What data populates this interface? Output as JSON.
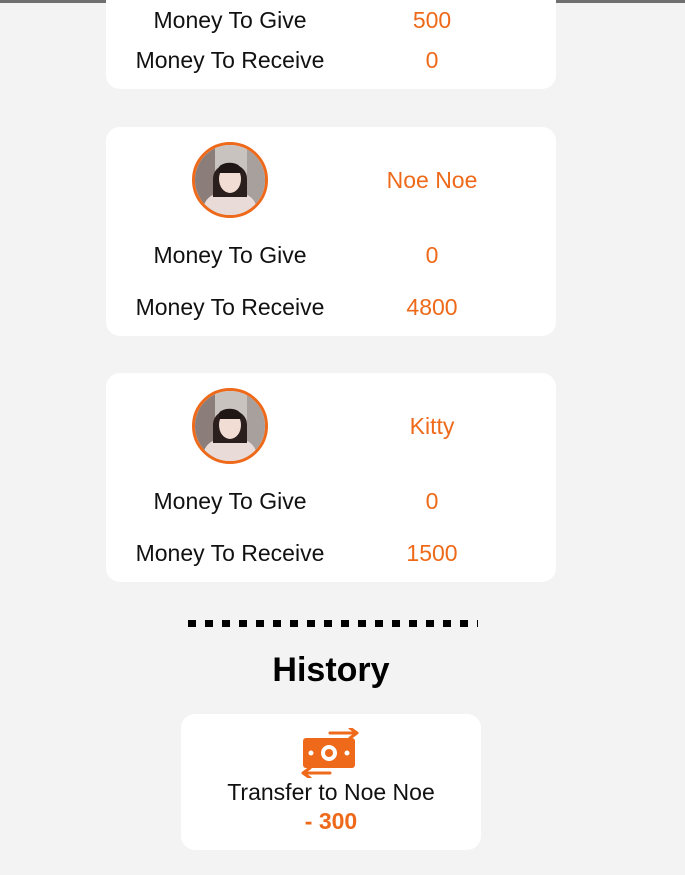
{
  "colors": {
    "accent": "#ee6a1a",
    "background": "#f3f3f3",
    "card": "#ffffff"
  },
  "cards": [
    {
      "name": "",
      "give_label": "Money To Give",
      "give_value": "500",
      "receive_label": "Money To Receive",
      "receive_value": "0"
    },
    {
      "name": "Noe Noe",
      "give_label": "Money To Give",
      "give_value": "0",
      "receive_label": "Money To Receive",
      "receive_value": "4800"
    },
    {
      "name": "Kitty",
      "give_label": "Money To Give",
      "give_value": "0",
      "receive_label": "Money To Receive",
      "receive_value": "1500"
    }
  ],
  "history": {
    "title": "History",
    "items": [
      {
        "icon": "money-transfer-icon",
        "text": "Transfer to Noe Noe",
        "amount": "- 300"
      }
    ]
  }
}
